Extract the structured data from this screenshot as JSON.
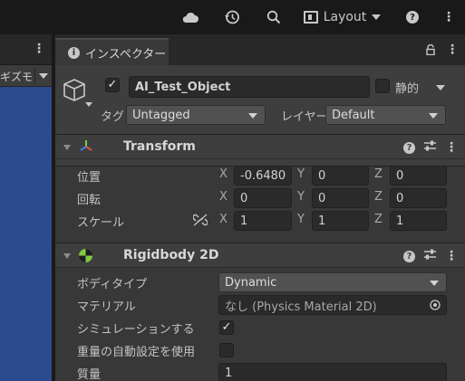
{
  "toolbar": {
    "cloud_icon": "cloud-icon",
    "history_icon": "history-icon",
    "search_icon": "search-icon",
    "layout_label": "Layout",
    "help_icon": "help-icon",
    "more_icon": "more-icon"
  },
  "left_panel": {
    "tab_fragment": "ギズモ"
  },
  "inspector": {
    "tab_label": "インスペクター",
    "object": {
      "active": true,
      "name": "AI_Test_Object",
      "static_label": "静的",
      "tag_label": "タグ",
      "tag_value": "Untagged",
      "layer_label": "レイヤー",
      "layer_value": "Default"
    },
    "transform": {
      "title": "Transform",
      "position_label": "位置",
      "rotation_label": "回転",
      "scale_label": "スケール",
      "axes": [
        "X",
        "Y",
        "Z"
      ],
      "position": [
        "-0.6480",
        "0",
        "0"
      ],
      "rotation": [
        "0",
        "0",
        "0"
      ],
      "scale": [
        "1",
        "1",
        "1"
      ]
    },
    "rigidbody": {
      "title": "Rigidbody 2D",
      "body_type_label": "ボディタイプ",
      "body_type_value": "Dynamic",
      "material_label": "マテリアル",
      "material_value": "なし (Physics Material 2D)",
      "simulated_label": "シミュレーションする",
      "simulated": true,
      "auto_mass_label": "重量の自動設定を使用",
      "auto_mass": false,
      "mass_label": "質量",
      "mass_value": "1"
    }
  },
  "colors": {
    "scene_blue": "#2c4a8e",
    "panel": "#383838",
    "header": "#3e3e3e"
  }
}
